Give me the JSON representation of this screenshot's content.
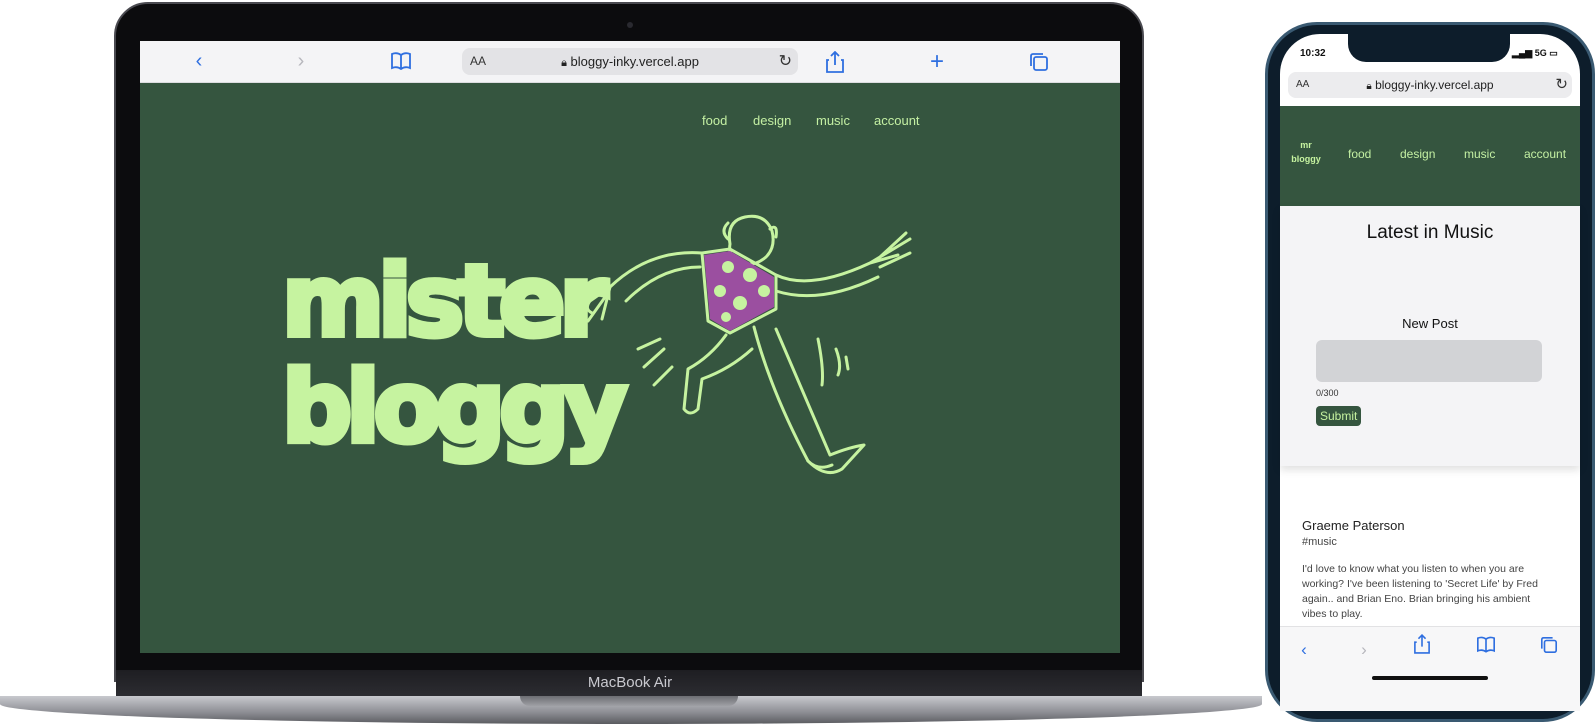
{
  "laptop": {
    "model_label": "MacBook Air",
    "browser": {
      "text_size_label": "AA",
      "url": "bloggy-inky.vercel.app"
    },
    "site": {
      "nav": [
        "food",
        "design",
        "music",
        "account"
      ],
      "logo_line1": "mister",
      "logo_line2": "bloggy"
    }
  },
  "phone": {
    "status": {
      "time": "10:32",
      "network": "5G"
    },
    "browser": {
      "text_size_label": "AA",
      "url": "bloggy-inky.vercel.app"
    },
    "site": {
      "logo": "mr bloggy",
      "nav": [
        "food",
        "design",
        "music",
        "account"
      ],
      "page_heading": "Latest in Music",
      "new_post_label": "New Post",
      "char_count": "0/300",
      "submit_label": "Submit",
      "post": {
        "author": "Graeme Paterson",
        "tag": "#music",
        "body": "I'd love to know what you listen to when you are working? I've been listening to 'Secret Life' by Fred again.. and Brian Eno. Brian bringing his ambient vibes to play."
      }
    }
  },
  "colors": {
    "site_bg": "#35553f",
    "accent": "#c4f0a3",
    "shirt": "#9b4fa0",
    "ios_blue": "#2f6fe0"
  },
  "icons": {
    "toolbar": [
      "back-icon",
      "forward-icon",
      "bookmarks-icon",
      "lock-icon",
      "reload-icon",
      "share-icon",
      "new-tab-icon",
      "tabs-icon"
    ]
  }
}
